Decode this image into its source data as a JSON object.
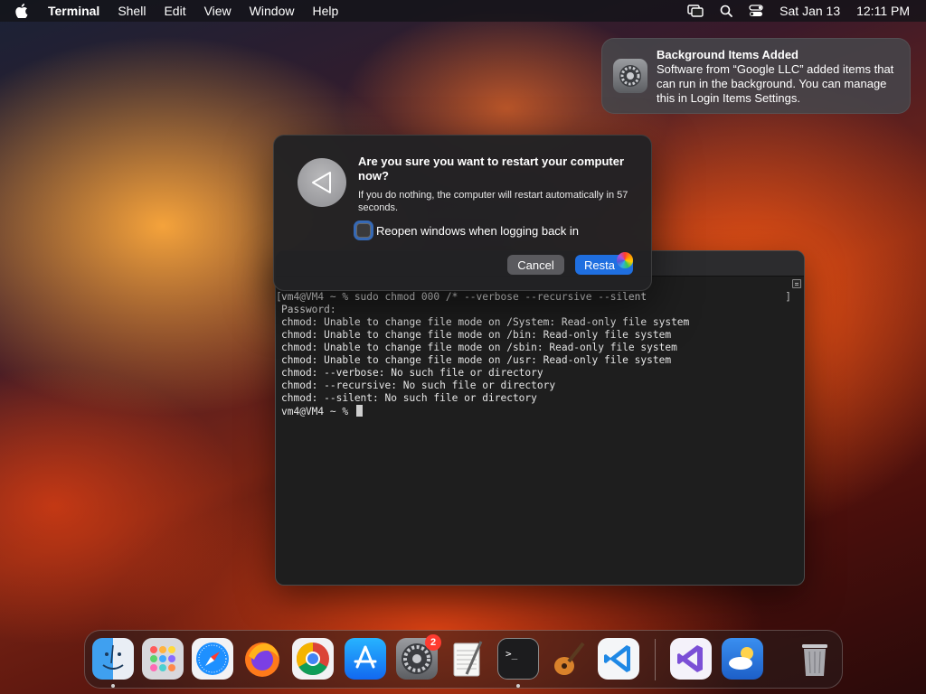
{
  "menubar": {
    "app_name": "Terminal",
    "items": [
      "Shell",
      "Edit",
      "View",
      "Window",
      "Help"
    ],
    "date": "Sat Jan 13",
    "time": "12:11 PM"
  },
  "notification": {
    "title": "Background Items Added",
    "body": "Software from “Google LLC” added items that can run in the background. You can manage this in Login Items Settings.",
    "icon": "system-settings-icon"
  },
  "terminal": {
    "lines": [
      "vm4@VM4 ~ % sudo chmod 000 /* --verbose --recursive --silent",
      "Password:",
      "chmod: Unable to change file mode on /System: Read-only file system",
      "chmod: Unable to change file mode on /bin: Read-only file system",
      "chmod: Unable to change file mode on /sbin: Read-only file system",
      "chmod: Unable to change file mode on /usr: Read-only file system",
      "chmod: --verbose: No such file or directory",
      "chmod: --recursive: No such file or directory",
      "chmod: --silent: No such file or directory"
    ],
    "prompt": "vm4@VM4 ~ %"
  },
  "dialog": {
    "title": "Are you sure you want to restart your computer now?",
    "message": "If you do nothing, the computer will restart automatically in 57 seconds.",
    "checkbox_label": "Reopen windows when logging back in",
    "cancel_label": "Cancel",
    "restart_label": "Resta"
  },
  "dock": {
    "apps": [
      "finder",
      "launchpad",
      "safari",
      "firefox",
      "chrome",
      "app-store",
      "system-settings",
      "textedit",
      "terminal",
      "garageband",
      "vscode",
      "visual-studio",
      "weather",
      "trash"
    ],
    "settings_badge": "2"
  },
  "colors": {
    "accent": "#1f6fe0",
    "badge": "#ff3b30"
  }
}
